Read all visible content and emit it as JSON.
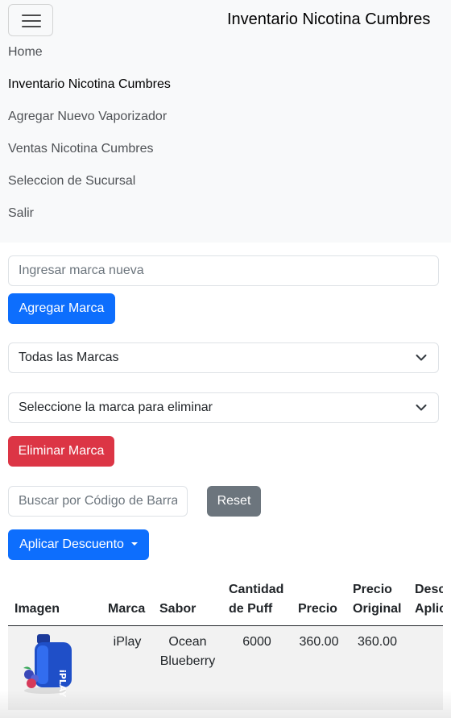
{
  "navbar": {
    "brand": "Inventario Nicotina Cumbres",
    "toggler_icon": "hamburger-menu-icon",
    "items": [
      {
        "label": "Home",
        "active": false
      },
      {
        "label": "Inventario Nicotina Cumbres",
        "active": true
      },
      {
        "label": "Agregar Nuevo Vaporizador",
        "active": false
      },
      {
        "label": "Ventas Nicotina Cumbres",
        "active": false
      },
      {
        "label": "Seleccion de Sucursal",
        "active": false
      },
      {
        "label": "Salir",
        "active": false
      }
    ]
  },
  "brand_form": {
    "new_brand_placeholder": "Ingresar marca nueva",
    "new_brand_value": "",
    "add_button": "Agregar Marca"
  },
  "filter_select": {
    "selected": "Todas las Marcas",
    "icon": "chevron-down-icon"
  },
  "delete_form": {
    "selected": "Seleccione la marca para eliminar",
    "delete_button": "Eliminar Marca"
  },
  "search": {
    "placeholder": "Buscar por Código de Barra",
    "value": "",
    "reset_button": "Reset"
  },
  "discount": {
    "button": "Aplicar Descuento"
  },
  "table": {
    "headers": [
      "Imagen",
      "Marca",
      "Sabor",
      "Cantidad de Puff",
      "Precio",
      "Precio Original",
      "Descuento Aplicado"
    ],
    "rows": [
      {
        "image": "vape-product-image",
        "marca": "iPlay",
        "sabor": "Ocean Blueberry",
        "puffs": "6000",
        "precio": "360.00",
        "precio_original": "360.00",
        "descuento": ""
      }
    ]
  },
  "colors": {
    "primary": "#0d6efd",
    "danger": "#dc3545",
    "secondary": "#6c757d",
    "navbar_bg": "#f8f9fa",
    "row_stripe": "#f2f2f2"
  }
}
